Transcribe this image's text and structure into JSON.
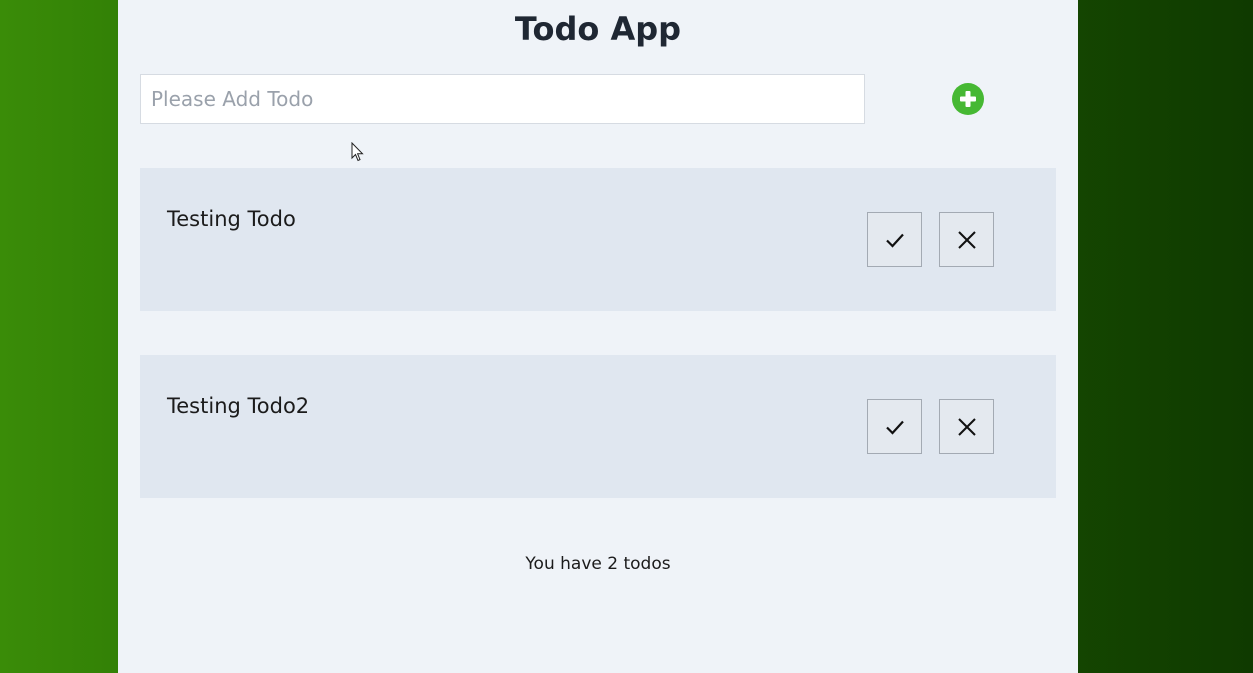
{
  "app": {
    "title": "Todo App"
  },
  "add_form": {
    "placeholder": "Please Add Todo",
    "value": "",
    "add_icon": "plus-circle-icon",
    "add_color": "#46b833"
  },
  "todos": [
    {
      "text": "Testing Todo",
      "complete_icon": "check-icon",
      "delete_icon": "close-icon"
    },
    {
      "text": "Testing Todo2",
      "complete_icon": "check-icon",
      "delete_icon": "close-icon"
    }
  ],
  "footer": {
    "count_text": "You have 2 todos"
  },
  "colors": {
    "panel_background": "#eff3f8",
    "item_background": "#e0e7f0",
    "background_gradient_start": "#3a8c08",
    "background_gradient_end": "#0f3a00"
  }
}
